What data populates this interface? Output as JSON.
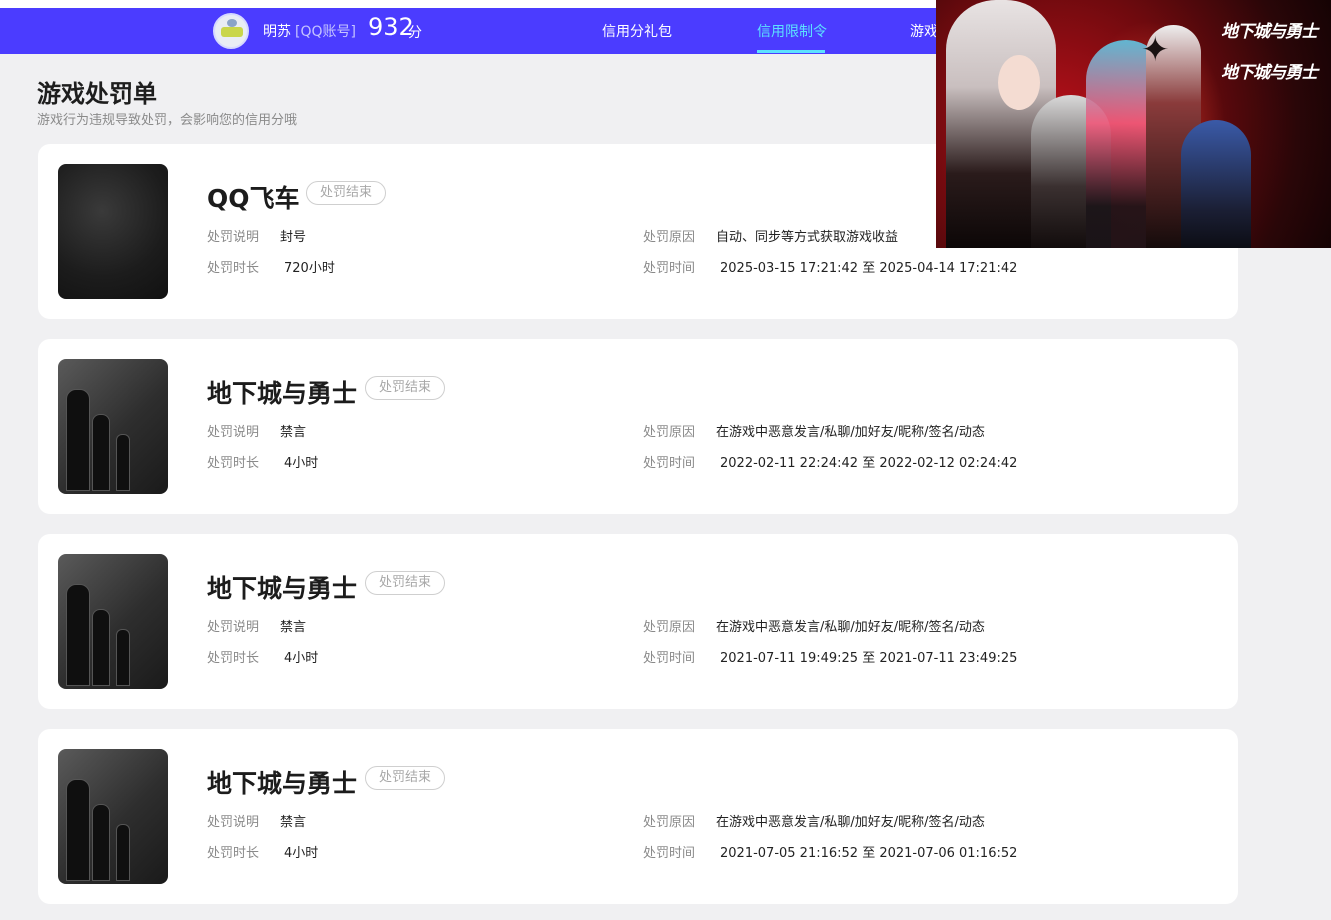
{
  "header": {
    "user_name": "明苏",
    "account_type": "[QQ账号]",
    "score": "932",
    "score_unit": "分",
    "nav": [
      {
        "label": "信用分礼包",
        "active": false
      },
      {
        "label": "信用限制令",
        "active": true
      },
      {
        "label": "游戏",
        "active": false
      }
    ]
  },
  "page": {
    "title": "游戏处罚单",
    "subtitle": "游戏行为违规导致处罚，会影响您的信用分哦"
  },
  "labels": {
    "desc": "处罚说明",
    "duration": "处罚时长",
    "reason": "处罚原因",
    "time": "处罚时间"
  },
  "records": [
    {
      "game": "QQ飞车",
      "status": "处罚结束",
      "desc": "封号",
      "duration": "720小时",
      "reason": "自动、同步等方式获取游戏收益",
      "time": "2025-03-15 17:21:42 至 2025-04-14 17:21:42"
    },
    {
      "game": "地下城与勇士",
      "status": "处罚结束",
      "desc": "禁言",
      "duration": "4小时",
      "reason": "在游戏中恶意发言/私聊/加好友/昵称/签名/动态",
      "time": "2022-02-11 22:24:42 至 2022-02-12 02:24:42"
    },
    {
      "game": "地下城与勇士",
      "status": "处罚结束",
      "desc": "禁言",
      "duration": "4小时",
      "reason": "在游戏中恶意发言/私聊/加好友/昵称/签名/动态",
      "time": "2021-07-11 19:49:25 至 2021-07-11 23:49:25"
    },
    {
      "game": "地下城与勇士",
      "status": "处罚结束",
      "desc": "禁言",
      "duration": "4小时",
      "reason": "在游戏中恶意发言/私聊/加好友/昵称/签名/动态",
      "time": "2021-07-05 21:16:52 至 2021-07-06 01:16:52"
    }
  ],
  "ad": {
    "logo_1": "地下城与勇士",
    "logo_2": "地下城与勇士"
  },
  "colors": {
    "navbar": "#4b3cff",
    "nav_active": "#5de2ff",
    "background": "#f0f0f2"
  }
}
